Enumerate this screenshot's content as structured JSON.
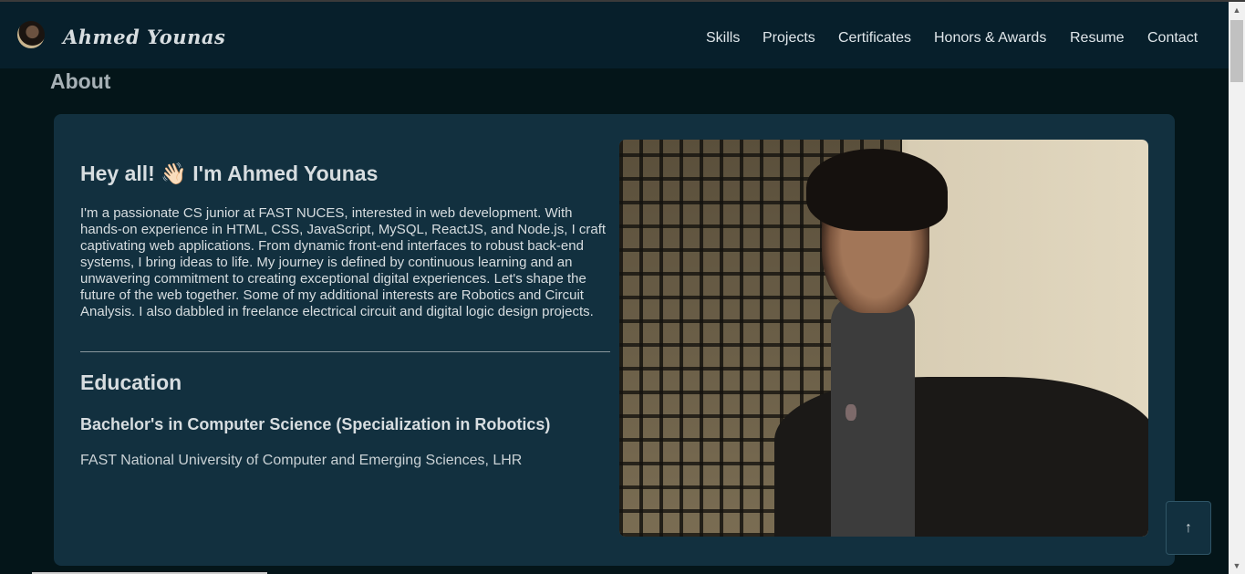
{
  "header": {
    "brand": "Ahmed Younas",
    "nav": [
      {
        "label": "Skills"
      },
      {
        "label": "Projects"
      },
      {
        "label": "Certificates"
      },
      {
        "label": "Honors & Awards"
      },
      {
        "label": "Resume"
      },
      {
        "label": "Contact"
      }
    ]
  },
  "about": {
    "section_title": "About",
    "greeting": "Hey all! 👋🏻 I'm Ahmed Younas",
    "bio": "I'm a passionate CS junior at FAST NUCES, interested in web development. With hands-on experience in HTML, CSS, JavaScript, MySQL, ReactJS, and Node.js, I craft captivating web applications. From dynamic front-end interfaces to robust back-end systems, I bring ideas to life. My journey is defined by continuous learning and an unwavering commitment to creating exceptional digital experiences. Let's shape the future of the web together. Some of my additional interests are Robotics and Circuit Analysis. I also dabbled in freelance electrical circuit and digital logic design projects.",
    "education_title": "Education",
    "degree": "Bachelor's in Computer Science (Specialization in Robotics)",
    "university": "FAST National University of Computer and Emerging Sciences, LHR"
  },
  "scroll_top": {
    "label": "↑"
  },
  "colors": {
    "page_bg": "#041519",
    "navbar_bg": "#071f2b",
    "card_bg": "#12303f",
    "text": "#d7dde0"
  }
}
